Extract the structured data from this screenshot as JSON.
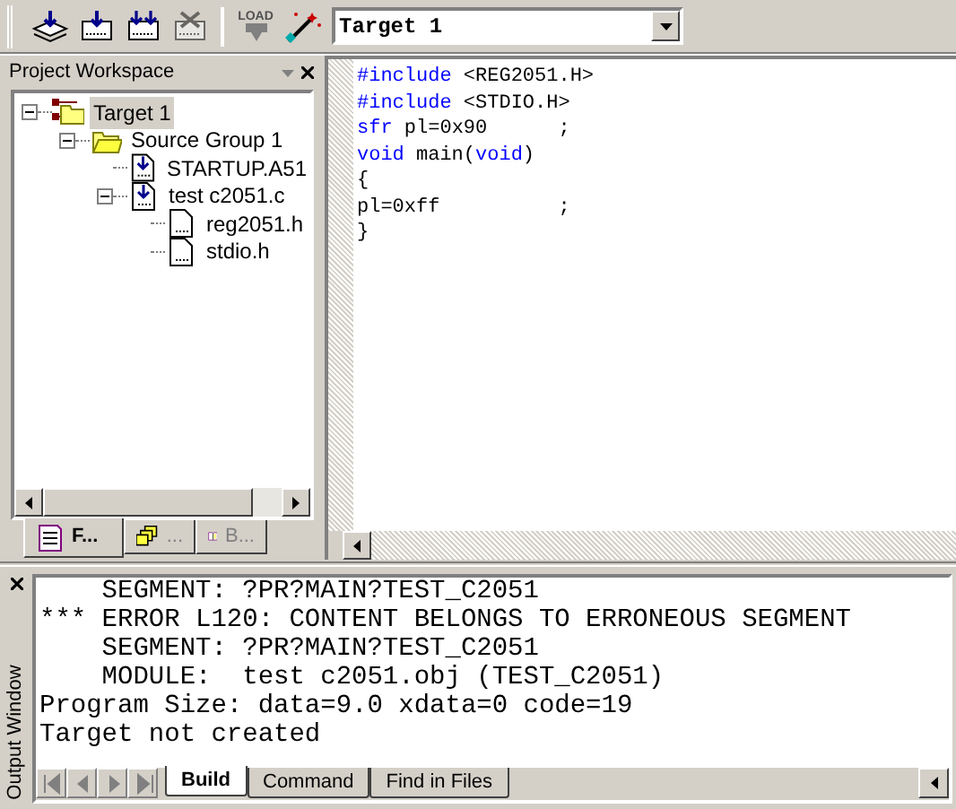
{
  "toolbar": {
    "buttons": [
      {
        "kind": "translate",
        "disabled": false
      },
      {
        "kind": "build",
        "disabled": false
      },
      {
        "kind": "rebuild",
        "disabled": false
      },
      {
        "kind": "stop",
        "disabled": true
      },
      {
        "kind": "load",
        "label": "LOAD",
        "disabled": true
      },
      {
        "kind": "options",
        "disabled": false
      }
    ],
    "target_select": {
      "value": "Target 1"
    }
  },
  "workspace": {
    "title": "Project Workspace",
    "tree": [
      {
        "label": "Target 1",
        "kind": "target",
        "selected": true,
        "expanded": true,
        "children": [
          {
            "label": "Source Group 1",
            "kind": "group",
            "selected": false,
            "expanded": true,
            "children": [
              {
                "label": "STARTUP.A51",
                "kind": "source",
                "selected": false
              },
              {
                "label": "test c2051.c",
                "kind": "source",
                "selected": false,
                "expanded": true,
                "children": [
                  {
                    "label": "reg2051.h",
                    "kind": "header",
                    "selected": false
                  },
                  {
                    "label": "stdio.h",
                    "kind": "header",
                    "selected": false
                  }
                ]
              }
            ]
          }
        ]
      }
    ],
    "tabs": [
      {
        "label": "F...",
        "kind": "files",
        "selected": true
      },
      {
        "label": "...",
        "kind": "regs",
        "selected": false
      },
      {
        "label": "B...",
        "kind": "books",
        "selected": false
      }
    ]
  },
  "editor": {
    "lines": [
      [
        {
          "text": "#include",
          "kind": "keyword"
        },
        {
          "text": " <REG2051.H>",
          "kind": "plain"
        }
      ],
      [
        {
          "text": "#include",
          "kind": "keyword"
        },
        {
          "text": " <STDIO.H>",
          "kind": "plain"
        }
      ],
      [
        {
          "text": "sfr",
          "kind": "keyword"
        },
        {
          "text": " pl=0x90      ;",
          "kind": "plain"
        }
      ],
      [
        {
          "text": "void",
          "kind": "keyword"
        },
        {
          "text": " main(",
          "kind": "plain"
        },
        {
          "text": "void",
          "kind": "keyword"
        },
        {
          "text": ")",
          "kind": "plain"
        }
      ],
      [
        {
          "text": "{",
          "kind": "plain"
        }
      ],
      [
        {
          "text": "pl=0xff          ;",
          "kind": "plain"
        }
      ],
      [
        {
          "text": "}",
          "kind": "plain"
        }
      ]
    ]
  },
  "output": {
    "title": "Output Window",
    "lines": [
      "    SEGMENT: ?PR?MAIN?TEST_C2051",
      "*** ERROR L120: CONTENT BELONGS TO ERRONEOUS SEGMENT",
      "    SEGMENT: ?PR?MAIN?TEST_C2051",
      "    MODULE:  test c2051.obj (TEST_C2051)",
      "Program Size: data=9.0 xdata=0 code=19",
      "Target not created"
    ],
    "tabs": [
      {
        "label": "Build",
        "selected": true
      },
      {
        "label": "Command",
        "selected": false
      },
      {
        "label": "Find in Files",
        "selected": false
      }
    ]
  }
}
